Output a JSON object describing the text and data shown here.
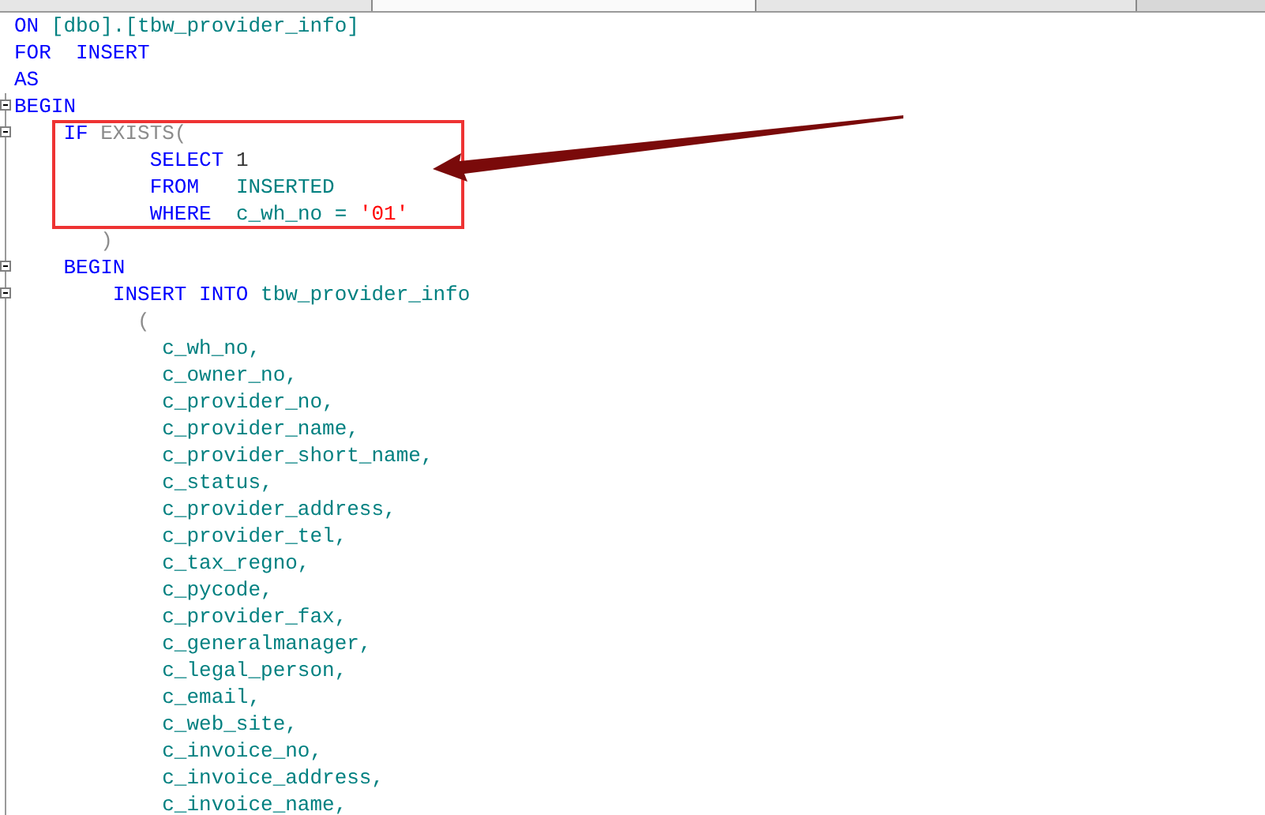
{
  "tabs": [
    {
      "selected": false
    },
    {
      "selected": true
    },
    {
      "selected": false
    }
  ],
  "annotations": [
    {
      "kind": "highlight-box"
    },
    {
      "kind": "arrow"
    }
  ],
  "lines": [
    {
      "collapsible": false,
      "tokens": [
        {
          "text": "ON ",
          "kind": "keyword"
        },
        {
          "text": "[dbo].[tbw_provider_info]",
          "kind": "identifier"
        }
      ]
    },
    {
      "collapsible": false,
      "tokens": [
        {
          "text": "FOR  INSERT",
          "kind": "keyword"
        }
      ]
    },
    {
      "collapsible": false,
      "tokens": [
        {
          "text": "AS",
          "kind": "keyword"
        }
      ]
    },
    {
      "collapsible": true,
      "tokens": [
        {
          "text": "BEGIN",
          "kind": "keyword"
        }
      ]
    },
    {
      "collapsible": true,
      "tokens": [
        {
          "text": "    IF ",
          "kind": "keyword"
        },
        {
          "text": "EXISTS(",
          "kind": "dim"
        }
      ]
    },
    {
      "collapsible": false,
      "tokens": [
        {
          "text": "           SELECT ",
          "kind": "keyword"
        },
        {
          "text": "1",
          "kind": "number"
        }
      ]
    },
    {
      "collapsible": false,
      "tokens": [
        {
          "text": "           FROM   ",
          "kind": "keyword"
        },
        {
          "text": "INSERTED",
          "kind": "identifier"
        }
      ]
    },
    {
      "collapsible": false,
      "tokens": [
        {
          "text": "           WHERE  ",
          "kind": "keyword"
        },
        {
          "text": "c_wh_no = ",
          "kind": "identifier"
        },
        {
          "text": "'01'",
          "kind": "string"
        }
      ]
    },
    {
      "collapsible": false,
      "tokens": [
        {
          "text": "       )",
          "kind": "dim"
        }
      ]
    },
    {
      "collapsible": true,
      "tokens": [
        {
          "text": "    BEGIN",
          "kind": "keyword"
        }
      ]
    },
    {
      "collapsible": true,
      "tokens": [
        {
          "text": "        INSERT INTO ",
          "kind": "keyword"
        },
        {
          "text": "tbw_provider_info",
          "kind": "identifier"
        }
      ]
    },
    {
      "collapsible": false,
      "tokens": [
        {
          "text": "          (",
          "kind": "dim"
        }
      ]
    },
    {
      "collapsible": false,
      "tokens": [
        {
          "text": "            c_wh_no,",
          "kind": "identifier"
        }
      ]
    },
    {
      "collapsible": false,
      "tokens": [
        {
          "text": "            c_owner_no,",
          "kind": "identifier"
        }
      ]
    },
    {
      "collapsible": false,
      "tokens": [
        {
          "text": "            c_provider_no,",
          "kind": "identifier"
        }
      ]
    },
    {
      "collapsible": false,
      "tokens": [
        {
          "text": "            c_provider_name,",
          "kind": "identifier"
        }
      ]
    },
    {
      "collapsible": false,
      "tokens": [
        {
          "text": "            c_provider_short_name,",
          "kind": "identifier"
        }
      ]
    },
    {
      "collapsible": false,
      "tokens": [
        {
          "text": "            c_status,",
          "kind": "identifier"
        }
      ]
    },
    {
      "collapsible": false,
      "tokens": [
        {
          "text": "            c_provider_address,",
          "kind": "identifier"
        }
      ]
    },
    {
      "collapsible": false,
      "tokens": [
        {
          "text": "            c_provider_tel,",
          "kind": "identifier"
        }
      ]
    },
    {
      "collapsible": false,
      "tokens": [
        {
          "text": "            c_tax_regno,",
          "kind": "identifier"
        }
      ]
    },
    {
      "collapsible": false,
      "tokens": [
        {
          "text": "            c_pycode,",
          "kind": "identifier"
        }
      ]
    },
    {
      "collapsible": false,
      "tokens": [
        {
          "text": "            c_provider_fax,",
          "kind": "identifier"
        }
      ]
    },
    {
      "collapsible": false,
      "tokens": [
        {
          "text": "            c_generalmanager,",
          "kind": "identifier"
        }
      ]
    },
    {
      "collapsible": false,
      "tokens": [
        {
          "text": "            c_legal_person,",
          "kind": "identifier"
        }
      ]
    },
    {
      "collapsible": false,
      "tokens": [
        {
          "text": "            c_email,",
          "kind": "identifier"
        }
      ]
    },
    {
      "collapsible": false,
      "tokens": [
        {
          "text": "            c_web_site,",
          "kind": "identifier"
        }
      ]
    },
    {
      "collapsible": false,
      "tokens": [
        {
          "text": "            c_invoice_no,",
          "kind": "identifier"
        }
      ]
    },
    {
      "collapsible": false,
      "tokens": [
        {
          "text": "            c_invoice_address,",
          "kind": "identifier"
        }
      ]
    },
    {
      "collapsible": false,
      "tokens": [
        {
          "text": "            c_invoice_name,",
          "kind": "identifier"
        }
      ]
    }
  ]
}
